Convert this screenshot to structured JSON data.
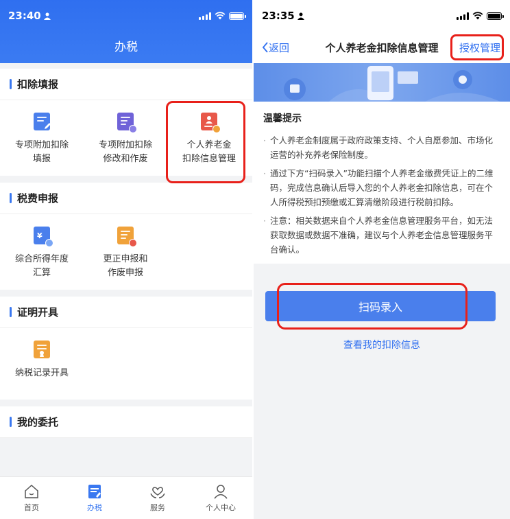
{
  "left": {
    "status_time": "23:40",
    "header_title": "办税",
    "sections": [
      {
        "title": "扣除填报",
        "items": [
          {
            "line1": "专项附加扣除",
            "line2": "填报",
            "icon": "edit-doc-icon",
            "color": "#4a7fec"
          },
          {
            "line1": "专项附加扣除",
            "line2": "修改和作废",
            "icon": "doc-settings-icon",
            "color": "#6f62d8"
          },
          {
            "line1": "个人养老金",
            "line2": "扣除信息管理",
            "icon": "pension-doc-icon",
            "color": "#e8584a"
          }
        ]
      },
      {
        "title": "税费申报",
        "items": [
          {
            "line1": "综合所得年度",
            "line2": "汇算",
            "icon": "tax-calc-icon",
            "color": "#4a7fec"
          },
          {
            "line1": "更正申报和",
            "line2": "作废申报",
            "icon": "doc-cancel-icon",
            "color": "#f0a23a"
          }
        ]
      },
      {
        "title": "证明开具",
        "items": [
          {
            "line1": "纳税记录开具",
            "line2": "",
            "icon": "certificate-icon",
            "color": "#f0a23a"
          }
        ]
      },
      {
        "title": "我的委托",
        "items": []
      }
    ],
    "tabs": [
      {
        "label": "首页",
        "icon": "home-icon"
      },
      {
        "label": "办税",
        "icon": "tax-doc-icon"
      },
      {
        "label": "服务",
        "icon": "heart-hands-icon"
      },
      {
        "label": "个人中心",
        "icon": "user-icon"
      }
    ]
  },
  "right": {
    "status_time": "23:35",
    "nav": {
      "back": "返回",
      "title": "个人养老金扣除信息管理",
      "auth": "授权管理"
    },
    "notice": {
      "title": "温馨提示",
      "items": [
        "个人养老金制度属于政府政策支持、个人自愿参加、市场化运营的补充养老保险制度。",
        "通过下方“扫码录入”功能扫描个人养老金缴费凭证上的二维码，完成信息确认后导入您的个人养老金扣除信息，可在个人所得税预扣预缴或汇算清缴阶段进行税前扣除。",
        "注意：相关数据来自个人养老金信息管理服务平台，如无法获取数据或数据不准确，建议与个人养老金信息管理服务平台确认。"
      ]
    },
    "scan_button": "扫码录入",
    "view_link": "查看我的扣除信息"
  },
  "colors": {
    "brand_blue": "#3a78f0",
    "highlight_red": "#e8201a"
  }
}
